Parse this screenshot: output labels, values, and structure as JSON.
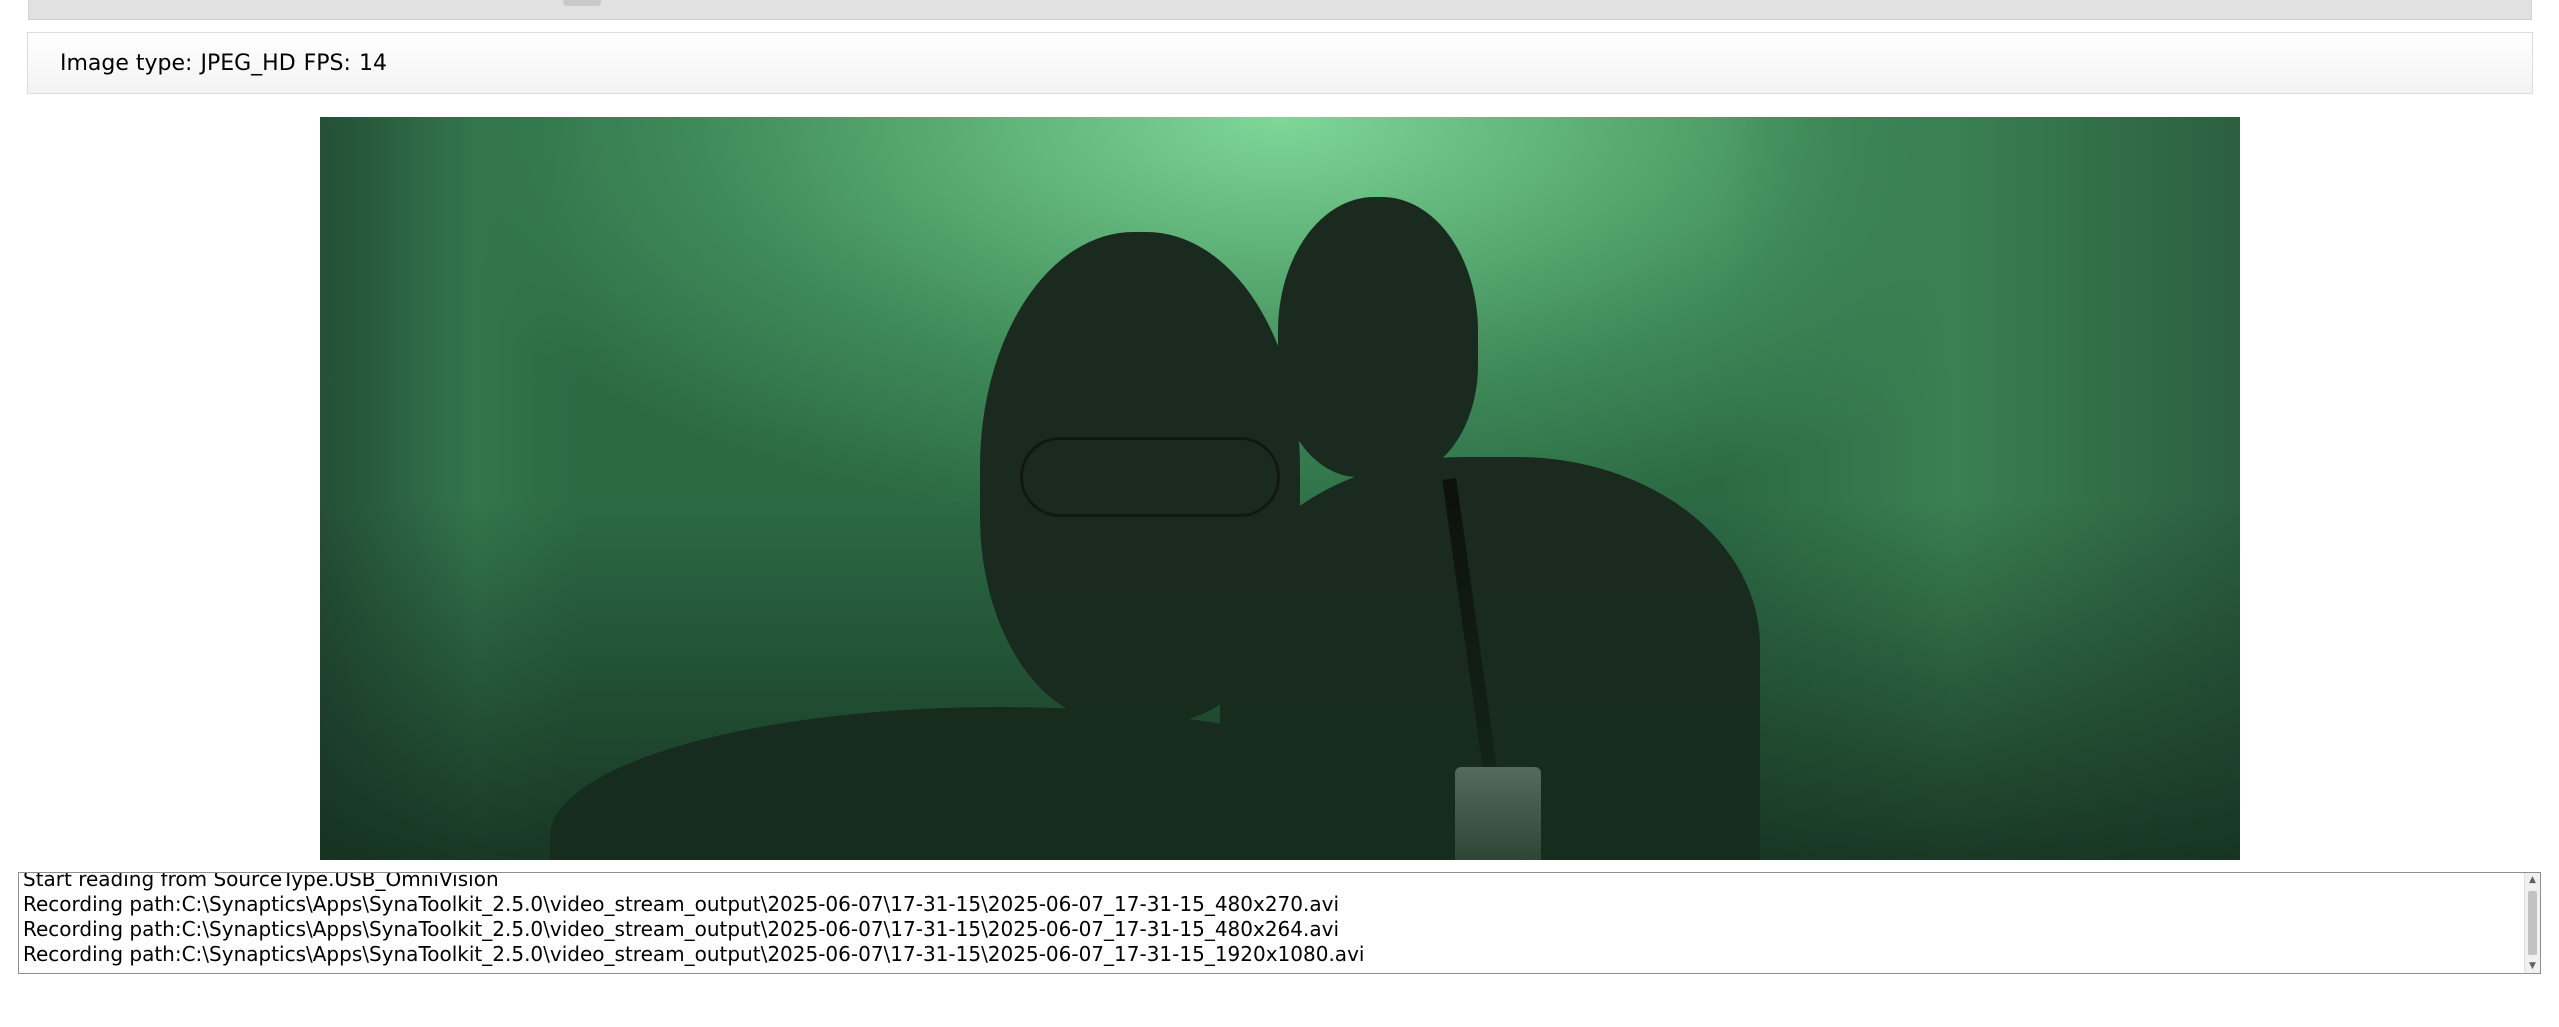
{
  "info_bar": {
    "image_type_label": "Image type:",
    "image_type_value": "JPEG_HD",
    "fps_label": "FPS:",
    "fps_value": "14"
  },
  "log": {
    "lines": [
      "Start reading from SourceType.USB_OmniVision",
      "Recording path:C:\\Synaptics\\Apps\\SynaToolkit_2.5.0\\video_stream_output\\2025-06-07\\17-31-15\\2025-06-07_17-31-15_480x270.avi",
      "Recording path:C:\\Synaptics\\Apps\\SynaToolkit_2.5.0\\video_stream_output\\2025-06-07\\17-31-15\\2025-06-07_17-31-15_480x264.avi",
      "Recording path:C:\\Synaptics\\Apps\\SynaToolkit_2.5.0\\video_stream_output\\2025-06-07\\17-31-15\\2025-06-07_17-31-15_1920x1080.avi"
    ]
  },
  "icons": {
    "scroll_up": "up-arrow-icon",
    "scroll_down": "down-arrow-icon"
  },
  "colors": {
    "frame_background": "#4f9e68",
    "panel_border": "#dcdcdc"
  }
}
